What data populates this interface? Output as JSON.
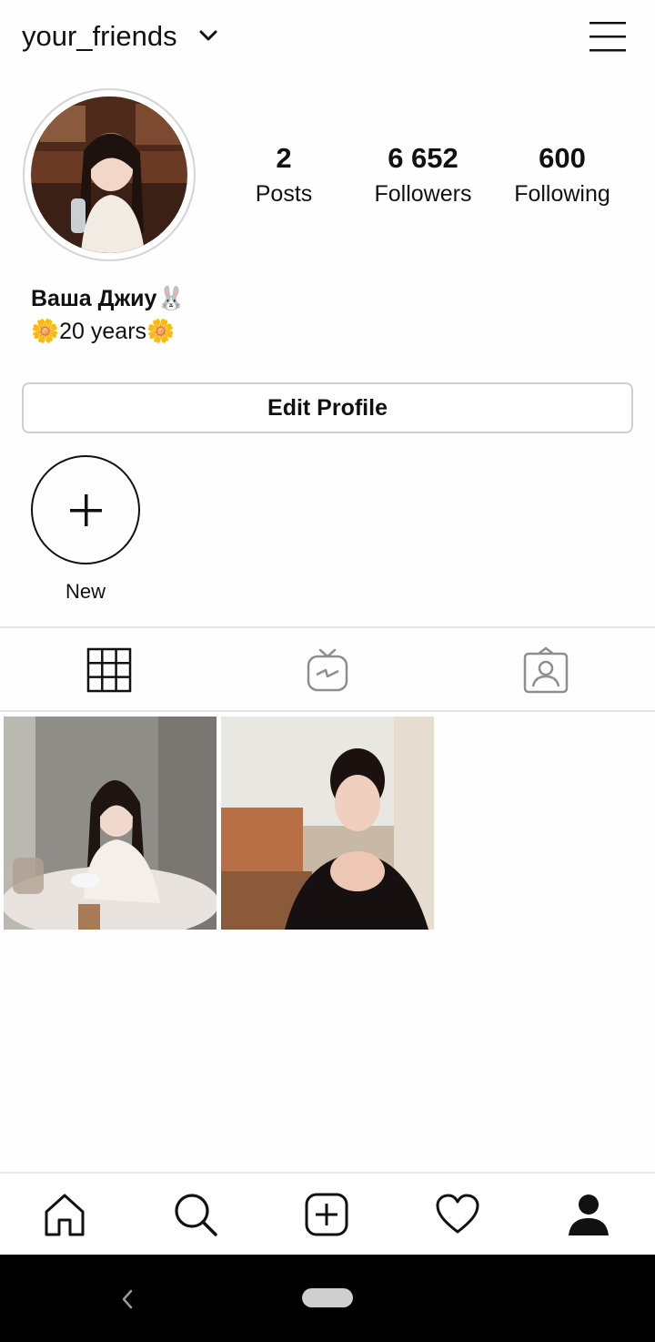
{
  "header": {
    "username": "your_friends",
    "chevron_icon": "chevron-down-icon",
    "menu_icon": "hamburger-menu-icon"
  },
  "profile": {
    "avatar": "profile-photo",
    "stats": [
      {
        "value": "2",
        "label": "Posts"
      },
      {
        "value": "6 652",
        "label": "Followers"
      },
      {
        "value": "600",
        "label": "Following"
      }
    ],
    "display_name": "Ваша Джиу🐰",
    "bio": "🌼20 years🌼"
  },
  "edit_profile_label": "Edit Profile",
  "highlights": {
    "new_label": "New",
    "new_icon": "plus-icon"
  },
  "tabs": [
    {
      "icon": "grid-icon",
      "active": true
    },
    {
      "icon": "igtv-icon",
      "active": false
    },
    {
      "icon": "tagged-user-icon",
      "active": false
    }
  ],
  "posts": [
    {
      "image": "photo-girl-at-cafe-table"
    },
    {
      "image": "photo-girl-resting-chin-on-hands"
    }
  ],
  "bottom_nav": [
    "home-icon",
    "search-icon",
    "add-post-icon",
    "heart-icon",
    "profile-icon"
  ],
  "colors": {
    "text": "#111111",
    "divider": "#e3e3e3",
    "inactive_icon": "#8e8e8e",
    "system_bar": "#000000"
  }
}
